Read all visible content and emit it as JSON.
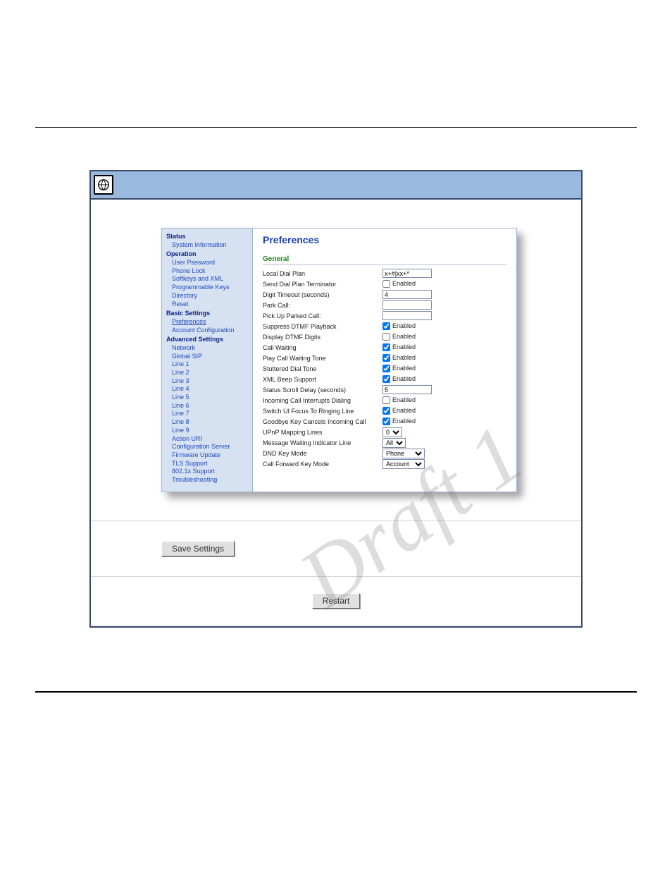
{
  "watermark": "Draft 1",
  "buttons": {
    "save": "Save Settings",
    "restart": "Restart"
  },
  "sidebar": {
    "status": {
      "heading": "Status",
      "items": [
        "System Information"
      ]
    },
    "operation": {
      "heading": "Operation",
      "items": [
        "User Password",
        "Phone Lock",
        "Softkeys and XML",
        "Programmable Keys",
        "Directory",
        "Reset"
      ]
    },
    "basic": {
      "heading": "Basic Settings",
      "items": [
        "Preferences",
        "Account Configuration"
      ]
    },
    "advanced": {
      "heading": "Advanced Settings",
      "items": [
        "Network",
        "Global SIP",
        "Line 1",
        "Line 2",
        "Line 3",
        "Line 4",
        "Line 5",
        "Line 6",
        "Line 7",
        "Line 8",
        "Line 9",
        "Action URI",
        "Configuration Server",
        "Firmware Update",
        "TLS Support",
        "802.1x Support",
        "Troubleshooting"
      ]
    }
  },
  "prefs": {
    "title": "Preferences",
    "section": "General",
    "rows": {
      "local_dial_plan": {
        "label": "Local Dial Plan",
        "value": "x+#|xx+*"
      },
      "send_terminator": {
        "label": "Send Dial Plan Terminator",
        "checked": false,
        "text": "Enabled"
      },
      "digit_timeout": {
        "label": "Digit Timeout (seconds)",
        "value": "4"
      },
      "park_call": {
        "label": "Park Call:",
        "value": ""
      },
      "pickup_parked": {
        "label": "Pick Up Parked Call:",
        "value": ""
      },
      "suppress_dtmf": {
        "label": "Suppress DTMF Playback",
        "checked": true,
        "text": "Enabled"
      },
      "display_dtmf": {
        "label": "Display DTMF Digits",
        "checked": false,
        "text": "Enabled"
      },
      "call_waiting": {
        "label": "Call Waiting",
        "checked": true,
        "text": "Enabled"
      },
      "play_cw_tone": {
        "label": "Play Call Waiting Tone",
        "checked": true,
        "text": "Enabled"
      },
      "stuttered": {
        "label": "Stuttered Dial Tone",
        "checked": true,
        "text": "Enabled"
      },
      "xml_beep": {
        "label": "XML Beep Support",
        "checked": true,
        "text": "Enabled"
      },
      "scroll_delay": {
        "label": "Status Scroll Delay (seconds)",
        "value": "5"
      },
      "incoming_interrupt": {
        "label": "Incoming Call Interrupts Dialing",
        "checked": false,
        "text": "Enabled"
      },
      "switch_focus": {
        "label": "Switch UI Focus To Ringing Line",
        "checked": true,
        "text": "Enabled"
      },
      "goodbye": {
        "label": "Goodbye Key Cancels Incoming Call",
        "checked": true,
        "text": "Enabled"
      },
      "upnp": {
        "label": "UPnP Mapping Lines",
        "value": "0"
      },
      "mwi": {
        "label": "Message Waiting Indicator Line",
        "value": "All"
      },
      "dnd": {
        "label": "DND Key Mode",
        "value": "Phone"
      },
      "cfwd": {
        "label": "Call Forward Key Mode",
        "value": "Account"
      }
    }
  }
}
